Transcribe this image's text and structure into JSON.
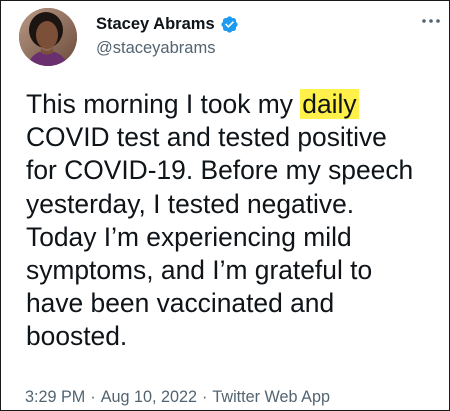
{
  "author": {
    "display_name": "Stacey Abrams",
    "handle": "@staceyabrams",
    "verified": true,
    "avatar_icon": "profile-photo"
  },
  "icons": {
    "verified": "verified-badge-icon",
    "more": "more-options-icon"
  },
  "colors": {
    "verified_badge": "#1d9bf0",
    "highlight": "#fff04a",
    "text_primary": "#0f1419",
    "text_secondary": "#536471"
  },
  "tweet": {
    "lines": [
      {
        "before": "This morning I took my ",
        "highlight": "daily",
        "after": ""
      },
      {
        "text": "COVID test and tested positive"
      },
      {
        "text": "for COVID-19. Before my speech"
      },
      {
        "text": "yesterday, I tested negative."
      },
      {
        "text": "Today I’m experiencing mild"
      },
      {
        "text": "symptoms, and I’m grateful to"
      },
      {
        "text": "have been vaccinated and"
      },
      {
        "text": "boosted."
      }
    ]
  },
  "meta": {
    "time": "3:29 PM",
    "date": "Aug 10, 2022",
    "source": "Twitter Web App",
    "separator": "·"
  }
}
